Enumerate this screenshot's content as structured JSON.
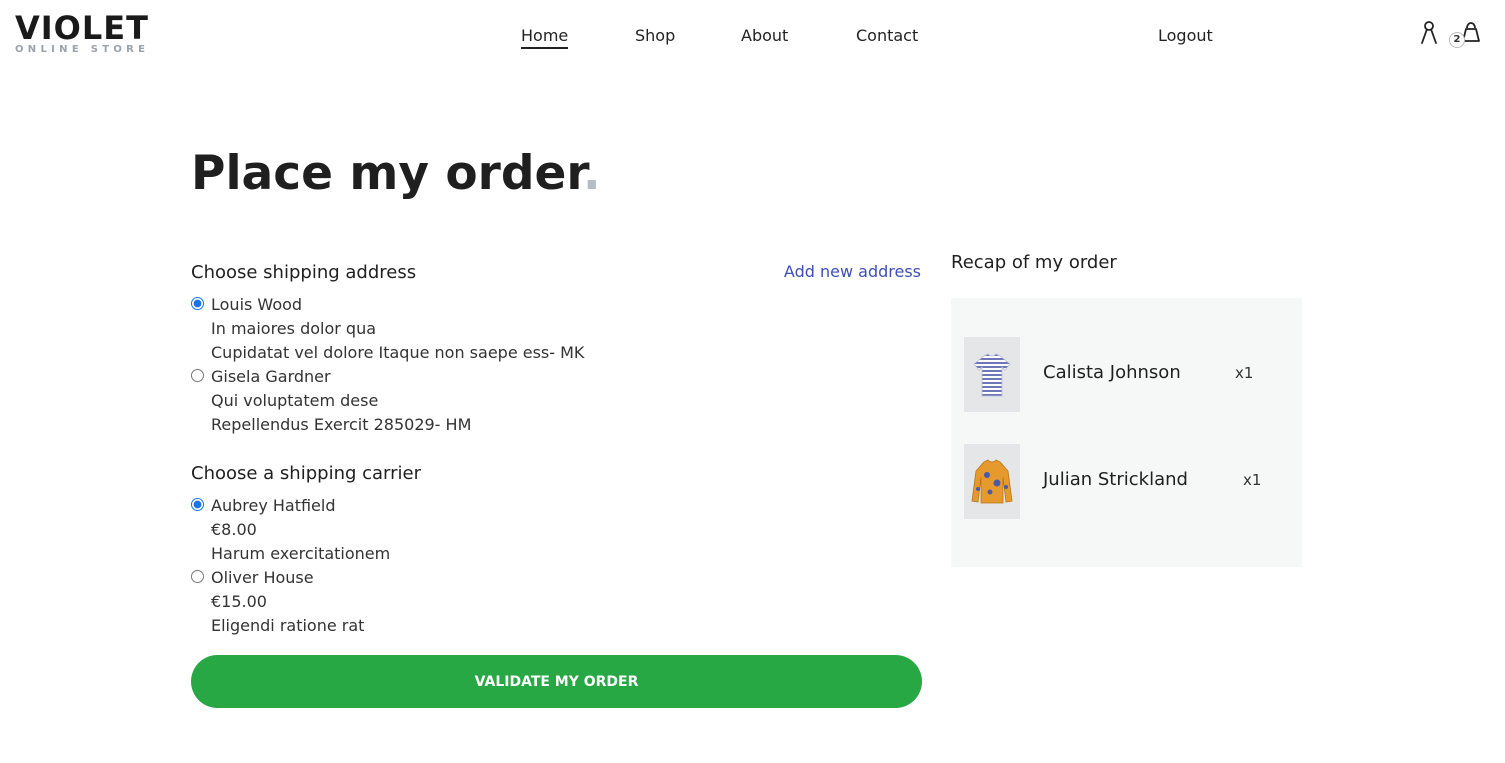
{
  "brand": {
    "name": "VIOLET",
    "tagline": "ONLINE STORE"
  },
  "nav": {
    "items": [
      {
        "label": "Home",
        "active": true
      },
      {
        "label": "Shop"
      },
      {
        "label": "About"
      },
      {
        "label": "Contact"
      }
    ],
    "logout": "Logout",
    "cart_count": "2",
    "icons": [
      "user-icon",
      "cart-bag-icon"
    ]
  },
  "page": {
    "title": "Place my order",
    "title_dot": "."
  },
  "shipping_address": {
    "title": "Choose shipping address",
    "add_link": "Add new address",
    "options": [
      {
        "name": "Louis Wood",
        "line1": "In maiores dolor qua",
        "line2": "Cupidatat vel dolore Itaque non saepe ess- MK",
        "selected": true
      },
      {
        "name": "Gisela Gardner",
        "line1": "Qui voluptatem dese",
        "line2": "Repellendus Exercit 285029- HM",
        "selected": false
      }
    ]
  },
  "shipping_carrier": {
    "title": "Choose a shipping carrier",
    "options": [
      {
        "name": "Aubrey Hatfield",
        "price": "€8.00",
        "description": "Harum exercitationem",
        "selected": true
      },
      {
        "name": "Oliver House",
        "price": "€15.00",
        "description": "Eligendi ratione rat",
        "selected": false
      }
    ]
  },
  "validate_label": "VALIDATE MY ORDER",
  "recap": {
    "title": "Recap of my order",
    "items": [
      {
        "name": "Calista Johnson",
        "qty": "x1",
        "image": "striped-tshirt"
      },
      {
        "name": "Julian Strickland",
        "qty": "x1",
        "image": "orange-sweater"
      }
    ]
  },
  "colors": {
    "accent_link": "#3d4fb8",
    "button_green": "#28a745",
    "recap_bg": "#f6f7f7",
    "radio_blue": "#1a73e8"
  }
}
